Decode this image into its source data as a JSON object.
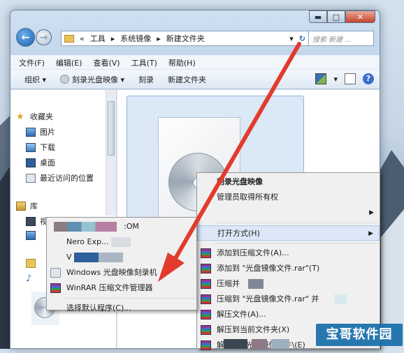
{
  "window": {
    "buttons": {
      "minimize": "▬",
      "maximize": "□",
      "close": "✕"
    },
    "address": {
      "prefix": "«",
      "parts": [
        "工具",
        "系统镜像",
        "新建文件夹"
      ],
      "separator": "▸",
      "dropdown": "▾",
      "refresh": "↻"
    },
    "search_placeholder": "搜索 新建 ..."
  },
  "menubar": [
    "文件(F)",
    "编辑(E)",
    "查看(V)",
    "工具(T)",
    "帮助(H)"
  ],
  "toolbar": {
    "organize": "组织 ▾",
    "burn_image": "刻录光盘映像 ▾",
    "burn": "刻录",
    "new_folder": "新建文件夹",
    "views": "▾",
    "help": "?"
  },
  "nav": {
    "favorites": "收藏夹",
    "fav_items": [
      "图片",
      "下载",
      "桌面",
      "最近访问的位置"
    ],
    "libraries": "库",
    "lib_items": [
      "视频"
    ]
  },
  "menu_main": {
    "items_top": [
      "刻录光盘映像",
      "管理员取得所有权"
    ],
    "open_with": "打开方式(H)",
    "rar_items": [
      "添加到压缩文件(A)...",
      "添加到 \"光盘镜像文件.rar\"(T)",
      "压缩并",
      "压缩到 \"光盘镜像文件.rar\" 并",
      "解压文件(A)...",
      "解压到当前文件夹(X)",
      "解压到 \"光盘镜像文件\\(E)"
    ]
  },
  "menu_sub": {
    "items": [
      ":OM",
      "Nero Exp...",
      "V",
      "Windows 光盘映像刻录机",
      "WinRAR 压缩文件管理器"
    ],
    "choose_default": "选择默认程序(C)..."
  },
  "watermark": "宝哥软件园",
  "colors": {
    "arrow": "#e23b2e",
    "window_frame": "#c2d6eb",
    "menu_bg": "#f0f0f0",
    "highlight": "#dce8f7",
    "watermark_bg": "#176eaa"
  }
}
